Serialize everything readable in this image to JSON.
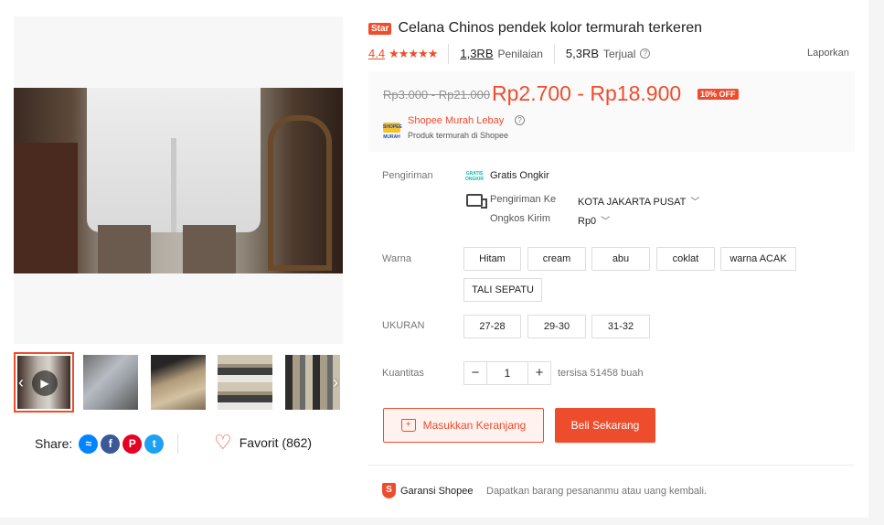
{
  "product": {
    "badge": "Star",
    "title": "Celana Chinos pendek kolor termurah terkeren",
    "rating": "4.4",
    "rating_count": "1,3RB",
    "rating_label": "Penilaian",
    "sold_count": "5,3RB",
    "sold_label": "Terjual",
    "report_label": "Laporkan"
  },
  "price": {
    "original": "Rp3.000 - Rp21.000",
    "current": "Rp2.700 - Rp18.900",
    "discount_badge": "10% OFF"
  },
  "shop": {
    "logo_text": "SHOPEE MURAH",
    "name": "Shopee Murah Lebay",
    "subtitle": "Produk termurah di Shopee"
  },
  "shipping": {
    "label": "Pengiriman",
    "free_icon_text": "GRATIS ONGKIR",
    "free_label": "Gratis Ongkir",
    "to_label": "Pengiriman Ke",
    "to_value": "KOTA JAKARTA PUSAT",
    "cost_label": "Ongkos Kirim",
    "cost_value": "Rp0"
  },
  "variants": {
    "color_label": "Warna",
    "colors": [
      "Hitam",
      "cream",
      "abu",
      "coklat",
      "warna ACAK",
      "TALI SEPATU"
    ],
    "size_label": "UKURAN",
    "sizes": [
      "27-28",
      "29-30",
      "31-32"
    ]
  },
  "quantity": {
    "label": "Kuantitas",
    "minus": "−",
    "plus": "+",
    "value": "1",
    "stock": "tersisa 51458 buah"
  },
  "actions": {
    "add_to_cart": "Masukkan Keranjang",
    "buy_now": "Beli Sekarang"
  },
  "guarantee": {
    "label": "Garansi Shopee",
    "description": "Dapatkan barang pesananmu atau uang kembali."
  },
  "gallery": {
    "share_label": "Share:",
    "favorite_label": "Favorit (862)",
    "thumbnail_count": 5
  },
  "colors": {
    "accent": "#ee4d2d",
    "price_bg": "#fafafa"
  }
}
